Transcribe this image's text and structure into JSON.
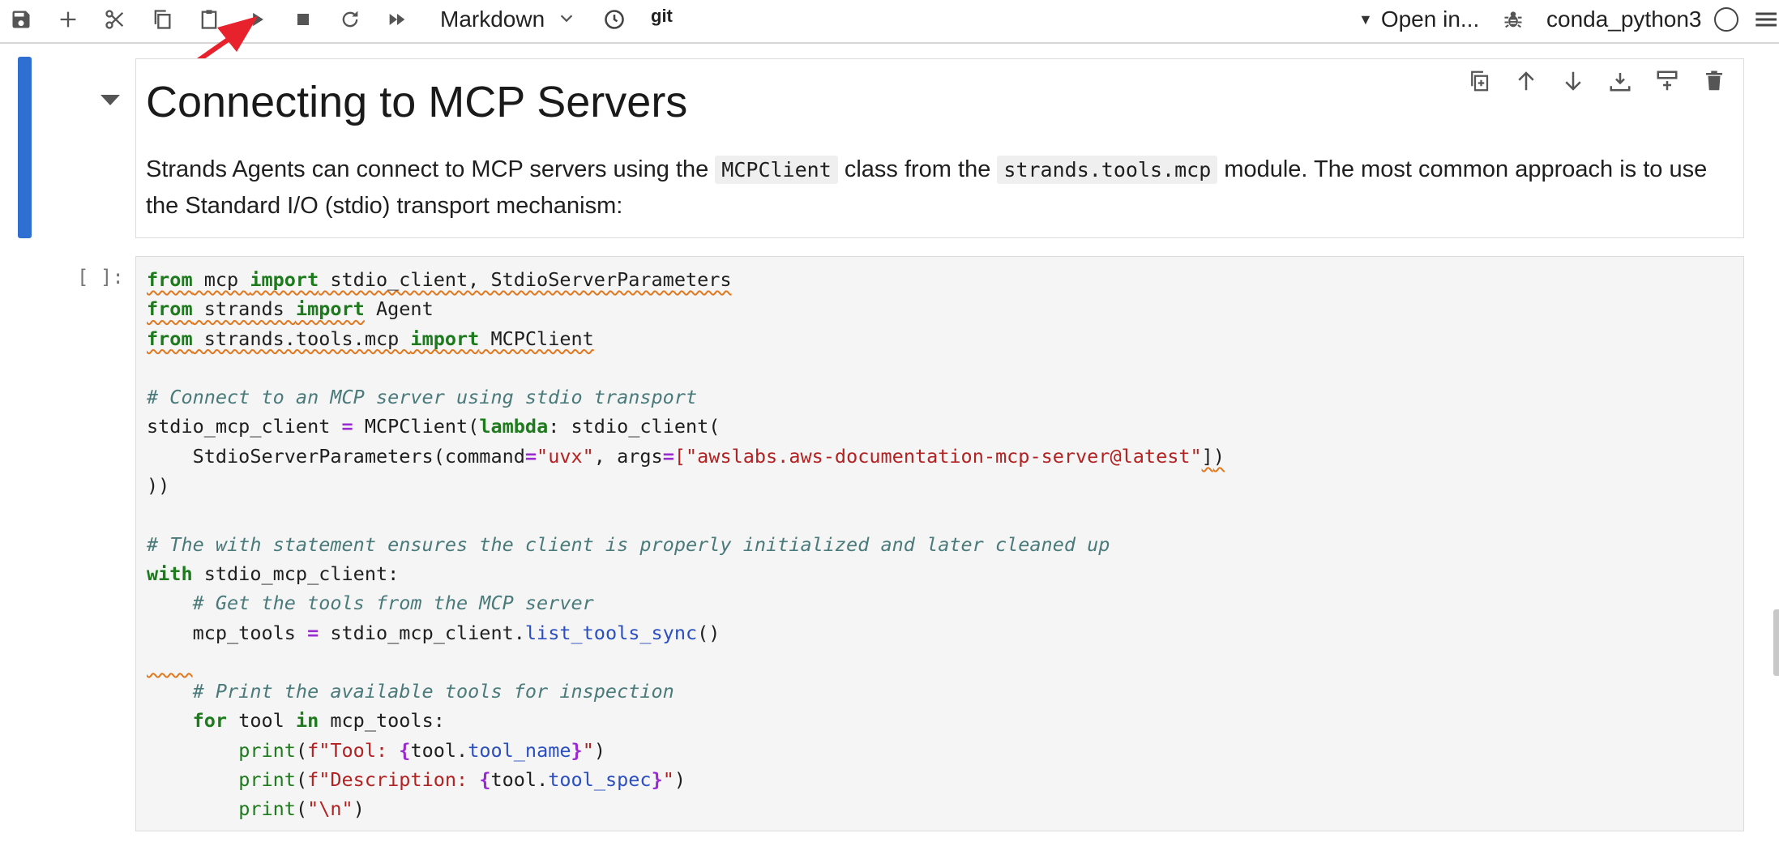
{
  "toolbar": {
    "cell_type": "Markdown",
    "git_label": "git",
    "open_in_label": "Open in...",
    "kernel_name": "conda_python3",
    "icons": [
      "save-icon",
      "add-cell-icon",
      "cut-icon",
      "copy-icon",
      "paste-icon",
      "run-icon",
      "stop-icon",
      "restart-icon",
      "run-all-icon",
      "chevron-down-icon",
      "history-icon",
      "debug-icon",
      "kernel-idle-icon",
      "menu-icon"
    ]
  },
  "annotation": {
    "color": "#e8222d"
  },
  "markdown_cell": {
    "title": "Connecting to MCP Servers",
    "para_1": "Strands Agents can connect to MCP servers using the ",
    "code_1": "MCPClient",
    "para_2": " class from the ",
    "code_2": "strands.tools.mcp",
    "para_3": " module. The most common approach is to use the Standard I/O (stdio) transport mechanism:",
    "actions": [
      "duplicate-cell-icon",
      "move-up-icon",
      "move-down-icon",
      "insert-above-icon",
      "insert-below-icon",
      "delete-cell-icon"
    ]
  },
  "code_cell": {
    "prompt": "[ ]:",
    "t": {
      "from": "from",
      "import": "import",
      "l1_mod": " mcp ",
      "l1_rest": " stdio_client, StdioServerParameters",
      "l2_mod": " strands ",
      "l2_rest": " Agent",
      "l3_mod": " strands.tools.mcp ",
      "l3_rest": " MCPClient",
      "c1": "# Connect to an MCP server using stdio transport",
      "l5_a": "stdio_mcp_client ",
      "eq": "=",
      "l5_b": " MCPClient(",
      "lambda": "lambda",
      "l5_c": ": stdio_client(",
      "l6_a": "    StdioServerParameters(command",
      "uvx": "\"uvx\"",
      "l6_b": ", args",
      "l6_open": "[",
      "aws": "\"awslabs.aws-documentation-mcp-server@latest\"",
      "l6_close": "]",
      "l6_end": ")",
      "l7": "))",
      "c2": "# The with statement ensures the client is properly initialized and later cleaned up",
      "with": "with",
      "l10": " stdio_mcp_client:",
      "c3": "    # Get the tools from the MCP server",
      "l12_a": "    mcp_tools ",
      "l12_b": " stdio_mcp_client.",
      "list_tools": "list_tools_sync",
      "l12_c": "()",
      "l13": "    ",
      "c4": "    # Print the available tools for inspection",
      "indent4": "    ",
      "for": "for",
      "l15_a": " tool ",
      "in": "in",
      "l15_b": " mcp_tools:",
      "indent8": "        ",
      "print": "print",
      "p1_a": "(",
      "p1_str1": "f\"Tool: ",
      "lb": "{",
      "tool_dot": "tool.",
      "tool_name": "tool_name",
      "rb": "}",
      "q_close": "\"",
      "p_end": ")",
      "p2_str1": "f\"Description: ",
      "tool_spec": "tool_spec",
      "nl": "\"\\n\""
    }
  }
}
